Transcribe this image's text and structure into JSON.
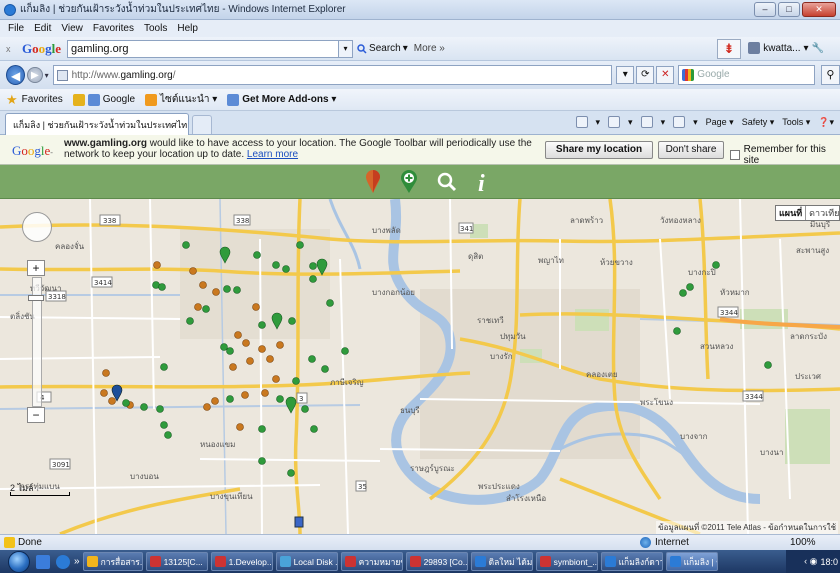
{
  "window": {
    "title": "แก็มลิง | ช่วยกันเฝ้าระวังน้ำท่วมในประเทศไทย - Windows Internet Explorer"
  },
  "menu": [
    "File",
    "Edit",
    "View",
    "Favorites",
    "Tools",
    "Help"
  ],
  "google_toolbar": {
    "logo": "Google",
    "search_value": "gamling.org",
    "search_label": "Search",
    "more_label": "More »",
    "user": "kwatta..."
  },
  "address": {
    "url_prefix": "http://www.",
    "url_domain": "gamling.org",
    "url_suffix": "/",
    "search_placeholder": "Google"
  },
  "favorites_bar": {
    "favorites_label": "Favorites",
    "items": [
      "Google",
      "ไซต์แนะนำ ▾",
      "Get More Add-ons ▾"
    ]
  },
  "tab": {
    "active_title": "แก็มลิง | ช่วยกันเฝ้าระวังน้ำท่วมในประเทศไทย"
  },
  "command_bar": {
    "page": "Page ▾",
    "safety": "Safety ▾",
    "tools": "Tools ▾"
  },
  "infobar": {
    "logo": "Google",
    "site_bold": "www.gamling.org",
    "message": " would like to have access to your location. The Google Toolbar will periodically use the network to keep your location up to date. ",
    "learn_more": "Learn more",
    "share_button": "Share my location",
    "dont_share_button": "Don't share",
    "remember_label": "Remember for this site"
  },
  "map": {
    "map_type_active": "แผนที่",
    "map_type_other": "ดาวเทียม",
    "scale_top": "2 ไมล์",
    "scale_bottom": "",
    "copyright": "ข้อมูลแผนที่ ©2011 Tele Atlas - ข้อกำหนดในการใช้",
    "labels": {
      "l1": "คลองจั่น",
      "l2": "บางพลัด",
      "l3": "ดุสิต",
      "l4": "พญาไท",
      "l5": "ห้วยขวาง",
      "l6": "บางกะปิ",
      "l7": "สะพานสูง",
      "l8": "ราชเทวี",
      "l9": "ปทุมวัน",
      "l10": "บางรัก",
      "l11": "คลองเตย",
      "l12": "พระโขนง",
      "l13": "ประเวศ",
      "l14": "บางจาก",
      "l15": "บางนา",
      "l16": "ราษฎร์บูรณะ",
      "l17": "บางขุนเทียน",
      "l18": "หนองแขม",
      "l19": "ตลิ่งชัน",
      "l20": "ทวีวัฒนา",
      "l21": "กระทุ่มแบน",
      "l22": "พระประแดง",
      "l23": "สำโรงเหนือ",
      "l24": "ธนบุรี",
      "l25": "ภาษีเจริญ",
      "l26": "บางกอกน้อย",
      "l27": "วังทองหลาง",
      "l28": "ลาดพร้าว",
      "l29": "หัวหมาก",
      "l30": "ลาดกระบัง",
      "l31": "บางบอน",
      "l32": "สวนหลวง",
      "l33": "มีนบุรี"
    }
  },
  "status": {
    "done": "Done",
    "zone": "Internet",
    "zoom": "100%"
  },
  "taskbar": {
    "items": [
      "การสื่อสาร...",
      "13125[C...",
      "1.Develop...",
      "Local Disk ...",
      "ความหมายข...",
      "29893 [Co...",
      "ดิลใหม่ ได้ม...",
      "symbiont_...",
      "แก็มลิงก์ดาว...",
      "แก็มลิง | ช่วย..."
    ],
    "time": "18:0"
  }
}
